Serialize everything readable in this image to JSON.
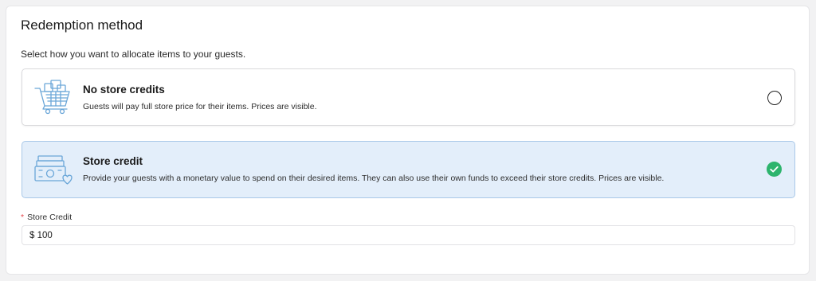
{
  "section": {
    "title": "Redemption method",
    "subtitle": "Select how you want to allocate items to your guests."
  },
  "options": [
    {
      "title": "No store credits",
      "description": "Guests will pay full store price for their items. Prices are visible.",
      "icon": "shopping-cart-icon",
      "selected": false
    },
    {
      "title": "Store credit",
      "description": "Provide your guests with a monetary value to spend on their desired items. They can also use their own funds to exceed their store credits. Prices are visible.",
      "icon": "money-heart-icon",
      "selected": true
    }
  ],
  "store_credit_field": {
    "required_marker": "*",
    "label": "Store Credit",
    "value": "$ 100"
  },
  "colors": {
    "selected_bg": "#e3eefa",
    "selected_border": "#a9c8e8",
    "check_green": "#2db46d",
    "icon_blue": "#6aa6d8",
    "required_red": "#e5484d"
  }
}
